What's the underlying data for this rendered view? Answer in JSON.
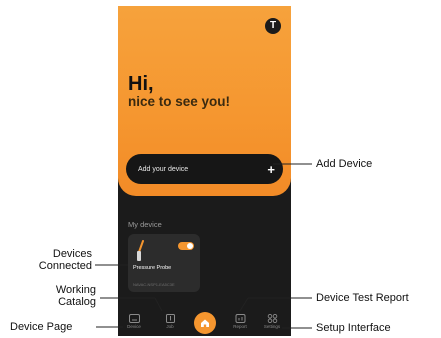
{
  "app": {
    "avatar_letter": "T",
    "greeting": "Hi,",
    "subtitle": "nice to see you!",
    "add_bar": {
      "label": "Add your device",
      "plus": "+"
    },
    "my_device": {
      "heading": "My device",
      "card": {
        "name": "Pressure Probe",
        "id": "NAVAC-NSP1-EA5C3E",
        "toggle_on": true
      }
    },
    "nav": {
      "items": [
        {
          "label": "Device",
          "icon": "tablet-icon"
        },
        {
          "label": "Job",
          "icon": "clipboard-icon"
        },
        {
          "label": "Home",
          "icon": "home-icon"
        },
        {
          "label": "Report",
          "icon": "chart-icon"
        },
        {
          "label": "Settings",
          "icon": "grid-icon"
        }
      ]
    }
  },
  "annotations": {
    "add_device": "Add Device",
    "devices_connected_1": "Devices",
    "devices_connected_2": "Connected",
    "working_catalog_1": "Working",
    "working_catalog_2": "Catalog",
    "device_page": "Device Page",
    "device_test_report": "Device Test Report",
    "setup_interface": "Setup Interface"
  },
  "colors": {
    "accent": "#f5962f",
    "dark": "#1b1b1b",
    "card": "#2c2c2c"
  }
}
